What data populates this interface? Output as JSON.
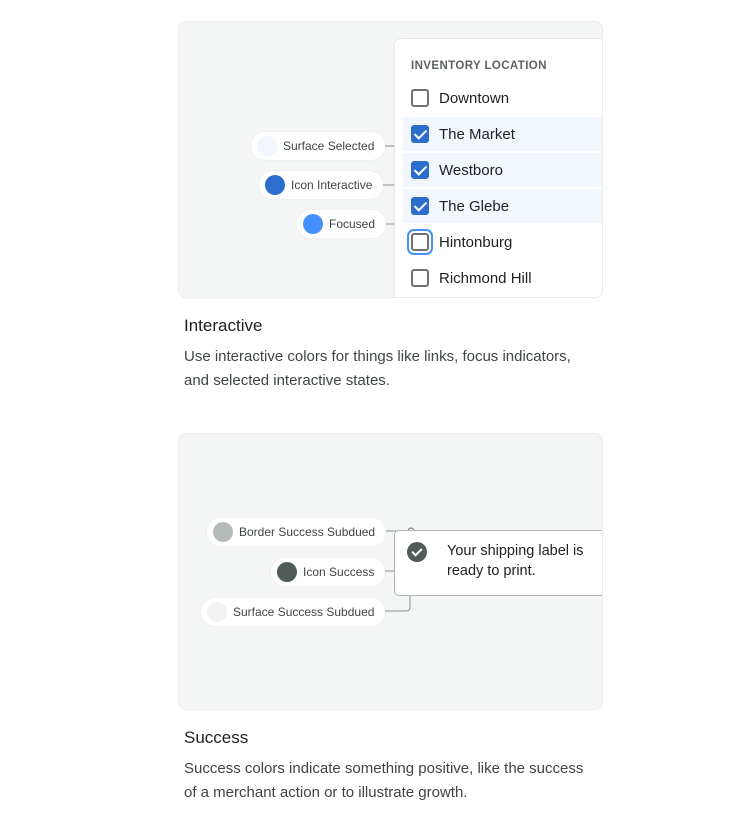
{
  "interactive": {
    "swatches": [
      {
        "label": "Surface Selected",
        "color": "#f2f6fd"
      },
      {
        "label": "Icon Interactive",
        "color": "#2c6ecb"
      },
      {
        "label": "Focused",
        "color": "#458fff"
      }
    ],
    "panel": {
      "title": "INVENTORY LOCATION",
      "locations": [
        {
          "label": "Downtown",
          "checked": false
        },
        {
          "label": "The Market",
          "checked": true
        },
        {
          "label": "Westboro",
          "checked": true
        },
        {
          "label": "The Glebe",
          "checked": true
        },
        {
          "label": "Hintonburg",
          "checked": false,
          "focused": true
        },
        {
          "label": "Richmond Hill",
          "checked": false
        }
      ]
    },
    "heading": "Interactive",
    "description": "Use interactive colors for things like links, focus indicators, and selected interactive states."
  },
  "success": {
    "swatches": [
      {
        "label": "Border Success Subdued",
        "color": "#b5bbb8"
      },
      {
        "label": "Icon Success",
        "color": "#4f5b59"
      },
      {
        "label": "Surface Success Subdued",
        "color": "#f1f2f1"
      }
    ],
    "toast": {
      "icon": "check-circle-icon",
      "message": "Your shipping label is ready to print."
    },
    "heading": "Success",
    "description": "Success colors indicate something positive, like the success of a merchant action or to illustrate growth."
  }
}
